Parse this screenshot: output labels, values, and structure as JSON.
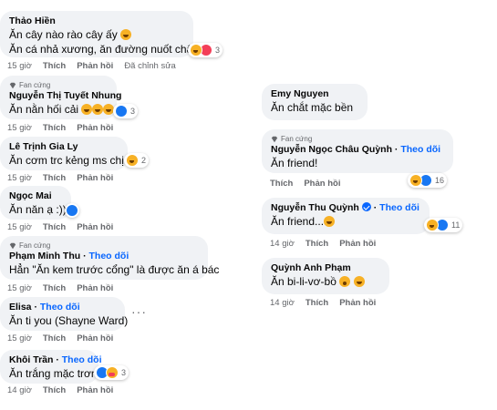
{
  "labels": {
    "fan": "Fan cứng",
    "follow": "Theo dõi",
    "like": "Thích",
    "reply": "Phản hồi",
    "edited": "Đã chỉnh sửa",
    "more": "···"
  },
  "left": [
    {
      "name": "Thảo Hiền",
      "lines": [
        "Ăn cây nào rào cây ấy",
        "Ăn cá nhả xương, ăn đường nuốt chậm"
      ],
      "time": "15 giờ",
      "edited": true,
      "reactions": [
        "haha",
        "love"
      ],
      "count": "3"
    },
    {
      "name": "Nguyễn Thị Tuyết Nhung",
      "fan": true,
      "lines": [
        "Ăn nằn hối cải"
      ],
      "time": "15 giờ",
      "reactions": [
        "like"
      ],
      "count": "3"
    },
    {
      "name": "Lê Trịnh Gia Ly",
      "lines": [
        "Ăn cơm trc kẻng ms chịu"
      ],
      "time": "15 giờ",
      "reactions": [
        "haha"
      ],
      "count": "2"
    },
    {
      "name": "Ngọc Mai",
      "lines": [
        "Ăn năn ạ :)))"
      ],
      "time": "15 giờ",
      "reactions": [
        "like"
      ]
    },
    {
      "name": "Phạm Minh Thu",
      "fan": true,
      "follow": true,
      "lines": [
        "Hẳn \"Ăn kem trước cổng\" là được ăn á bác"
      ],
      "time": "15 giờ"
    },
    {
      "name": "Elisa",
      "follow": true,
      "lines": [
        "Ăn ti you (Shayne Ward)"
      ],
      "time": "15 giờ"
    },
    {
      "name": "Khôi Trần",
      "follow": true,
      "lines": [
        "Ăn trắng mặc trơn"
      ],
      "time": "14 giờ",
      "reactions": [
        "like",
        "care"
      ],
      "count": "3"
    }
  ],
  "right": [
    {
      "name": "Emy Nguyen",
      "lines": [
        "Ăn chắt mặc bền"
      ]
    },
    {
      "name": "Nguyễn Ngọc Châu Quỳnh",
      "fan": true,
      "follow": true,
      "lines": [
        "Ăn friend!"
      ],
      "reactions": [
        "haha",
        "like"
      ],
      "count": "16"
    },
    {
      "name": "Nguyễn Thu Quỳnh",
      "verified": true,
      "follow": true,
      "lines": [
        "Ăn friend..."
      ],
      "time": "14 giờ",
      "reactions": [
        "haha",
        "like"
      ],
      "count": "11"
    },
    {
      "name": "Quỳnh Anh Phạm",
      "lines": [
        "Ăn bi-li-vơ-bồ"
      ],
      "time": "14 giờ"
    }
  ]
}
